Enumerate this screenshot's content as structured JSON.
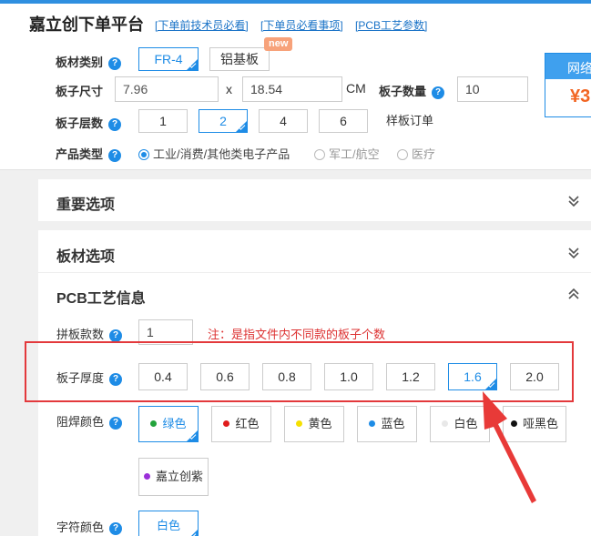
{
  "header": {
    "title": "嘉立创下单平台",
    "links": [
      "[下单前技术员必看]",
      "[下单员必看事项]",
      "[PCB工艺参数]"
    ]
  },
  "board_material": {
    "label": "板材类别",
    "options": [
      "FR-4",
      "铝基板"
    ],
    "selected": "FR-4",
    "new_badge": "new"
  },
  "board_size": {
    "label": "板子尺寸",
    "width": "7.96",
    "times": "x",
    "height": "18.54",
    "unit": "CM"
  },
  "board_qty": {
    "label": "板子数量",
    "value": "10"
  },
  "layers": {
    "label": "板子层数",
    "options": [
      "1",
      "2",
      "4",
      "6"
    ],
    "selected": "2",
    "sample_order": "样板订单"
  },
  "product_type": {
    "label": "产品类型",
    "options": [
      "工业/消费/其他类电子产品",
      "军工/航空",
      "医疗"
    ],
    "selected": "工业/消费/其他类电子产品"
  },
  "price_box": {
    "title": "网络",
    "value": "¥3"
  },
  "sections": {
    "important": "重要选项",
    "material": "板材选项",
    "pcb_process": "PCB工艺信息"
  },
  "panel_count": {
    "label": "拼板款数",
    "value": "1",
    "note": "注：是指文件内不同款的板子个数"
  },
  "thickness": {
    "label": "板子厚度",
    "options": [
      "0.4",
      "0.6",
      "0.8",
      "1.0",
      "1.2",
      "1.6",
      "2.0"
    ],
    "selected": "1.6"
  },
  "solder_mask": {
    "label": "阻焊颜色",
    "options": [
      {
        "label": "绿色",
        "color": "#22a33b"
      },
      {
        "label": "红色",
        "color": "#e01b1b"
      },
      {
        "label": "黄色",
        "color": "#f5e000"
      },
      {
        "label": "蓝色",
        "color": "#1e8ce6"
      },
      {
        "label": "白色",
        "color": "#e8e8e8"
      },
      {
        "label": "哑黑色",
        "color": "#111111"
      },
      {
        "label": "嘉立创紫",
        "color": "#9b30d9"
      }
    ],
    "selected": "绿色"
  },
  "silkscreen": {
    "label": "字符颜色",
    "selected": "白色"
  },
  "colors": {
    "accent": "#1e8ce6",
    "highlight_box": "#e3393c",
    "price": "#f26522"
  }
}
